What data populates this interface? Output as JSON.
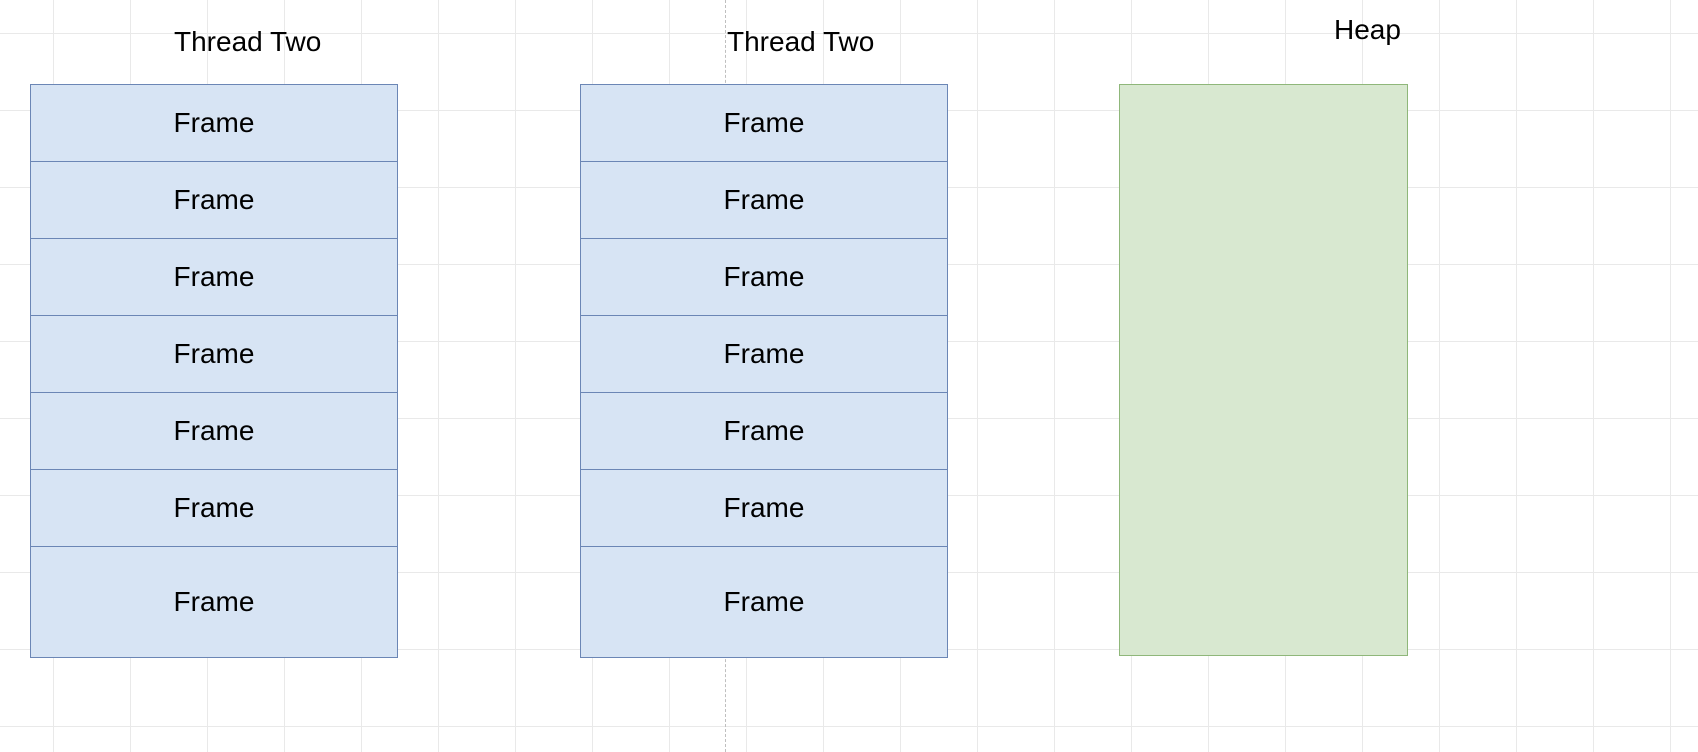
{
  "labels": {
    "thread1": "Thread Two",
    "thread2": "Thread Two",
    "heap": "Heap"
  },
  "stacks": {
    "s1": {
      "frames": [
        "Frame",
        "Frame",
        "Frame",
        "Frame",
        "Frame",
        "Frame",
        "Frame"
      ]
    },
    "s2": {
      "frames": [
        "Frame",
        "Frame",
        "Frame",
        "Frame",
        "Frame",
        "Frame",
        "Frame"
      ]
    }
  }
}
